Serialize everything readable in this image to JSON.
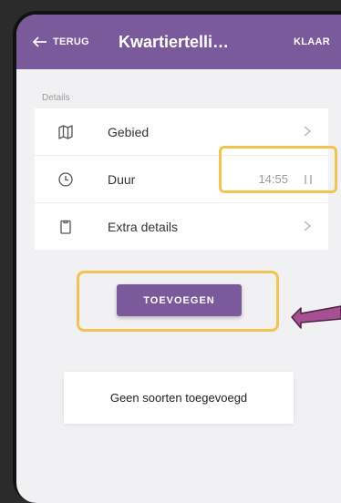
{
  "header": {
    "back_label": "TERUG",
    "title": "Kwartiertelli…",
    "done_label": "KLAAR"
  },
  "details": {
    "section_label": "Details",
    "items": [
      {
        "label": "Gebied",
        "icon": "map-icon"
      },
      {
        "label": "Duur",
        "icon": "clock-icon",
        "value": "14:55"
      },
      {
        "label": "Extra details",
        "icon": "clipboard-icon"
      }
    ]
  },
  "actions": {
    "add_label": "TOEVOEGEN"
  },
  "species": {
    "empty_message": "Geen soorten toegevoegd"
  },
  "colors": {
    "header": "#7b5a9b",
    "highlight": "#f2c34f",
    "arrow": "#a64f93"
  }
}
